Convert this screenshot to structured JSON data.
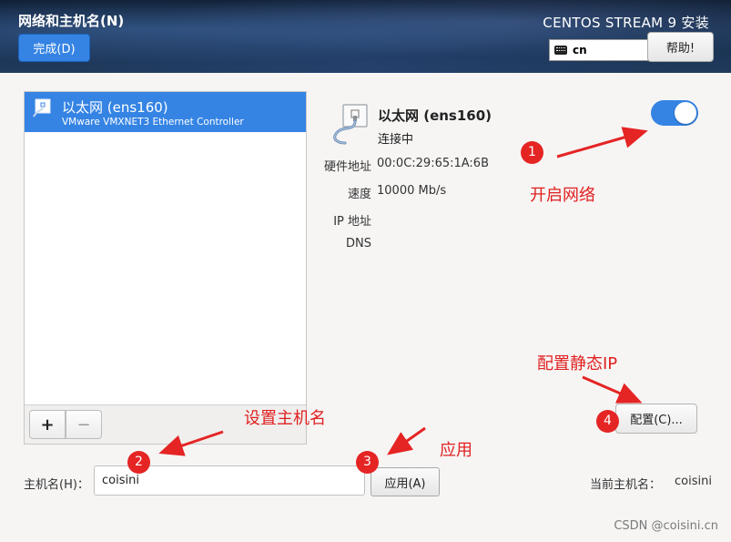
{
  "header": {
    "title": "网络和主机名(N)",
    "done_label": "完成(D)",
    "product": "CENTOS STREAM 9 安装",
    "keyboard_layout": "cn",
    "help_label": "帮助!"
  },
  "device_list": {
    "items": [
      {
        "name": "以太网 (ens160)",
        "description": "VMware VMXNET3 Ethernet Controller",
        "selected": true
      }
    ],
    "add_label": "+",
    "remove_label": "−"
  },
  "device_detail": {
    "name": "以太网 (ens160)",
    "status": "连接中",
    "toggle_on": true,
    "fields": [
      {
        "label": "硬件地址",
        "value": "00:0C:29:65:1A:6B"
      },
      {
        "label": "速度",
        "value": "10000 Mb/s"
      },
      {
        "label": "IP 地址",
        "value": ""
      },
      {
        "label": "DNS",
        "value": ""
      }
    ],
    "configure_label": "配置(C)..."
  },
  "hostname": {
    "label": "主机名(H)：",
    "value": "coisini",
    "apply_label": "应用(A)",
    "current_label": "当前主机名：",
    "current_value": "coisini"
  },
  "annotations": {
    "badges": [
      "1",
      "2",
      "3",
      "4"
    ],
    "enable_network": "开启网络",
    "set_hostname": "设置主机名",
    "apply": "应用",
    "static_ip": "配置静态IP",
    "color": "#e02020"
  },
  "watermark": "CSDN @coisini.cn",
  "colors": {
    "accent": "#3584e4",
    "annotation": "#e52424"
  }
}
